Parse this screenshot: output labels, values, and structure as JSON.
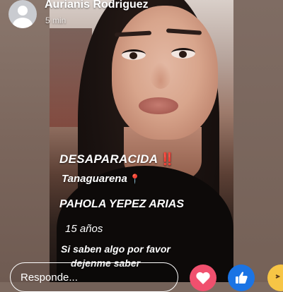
{
  "header": {
    "author_name": "Aurianis Rodriguez",
    "timestamp": "5 min"
  },
  "story": {
    "lines": {
      "missing": "DESAPARACIDA",
      "missing_mark": "‼️",
      "location": "Tanaguarena",
      "location_mark": "📍",
      "person_name": "PAHOLA YEPEZ ARIAS",
      "age": "15 años",
      "message_line1": "Si saben algo por favor",
      "message_line2": "dejenme saber"
    }
  },
  "reply": {
    "placeholder": "Responde..."
  },
  "reactions": [
    {
      "icon": "heart-icon",
      "color": "#f0506e"
    },
    {
      "icon": "thumbs-up-icon",
      "color": "#1b74e4"
    },
    {
      "icon": "laughing-face-icon",
      "color": "#f7c545"
    }
  ]
}
